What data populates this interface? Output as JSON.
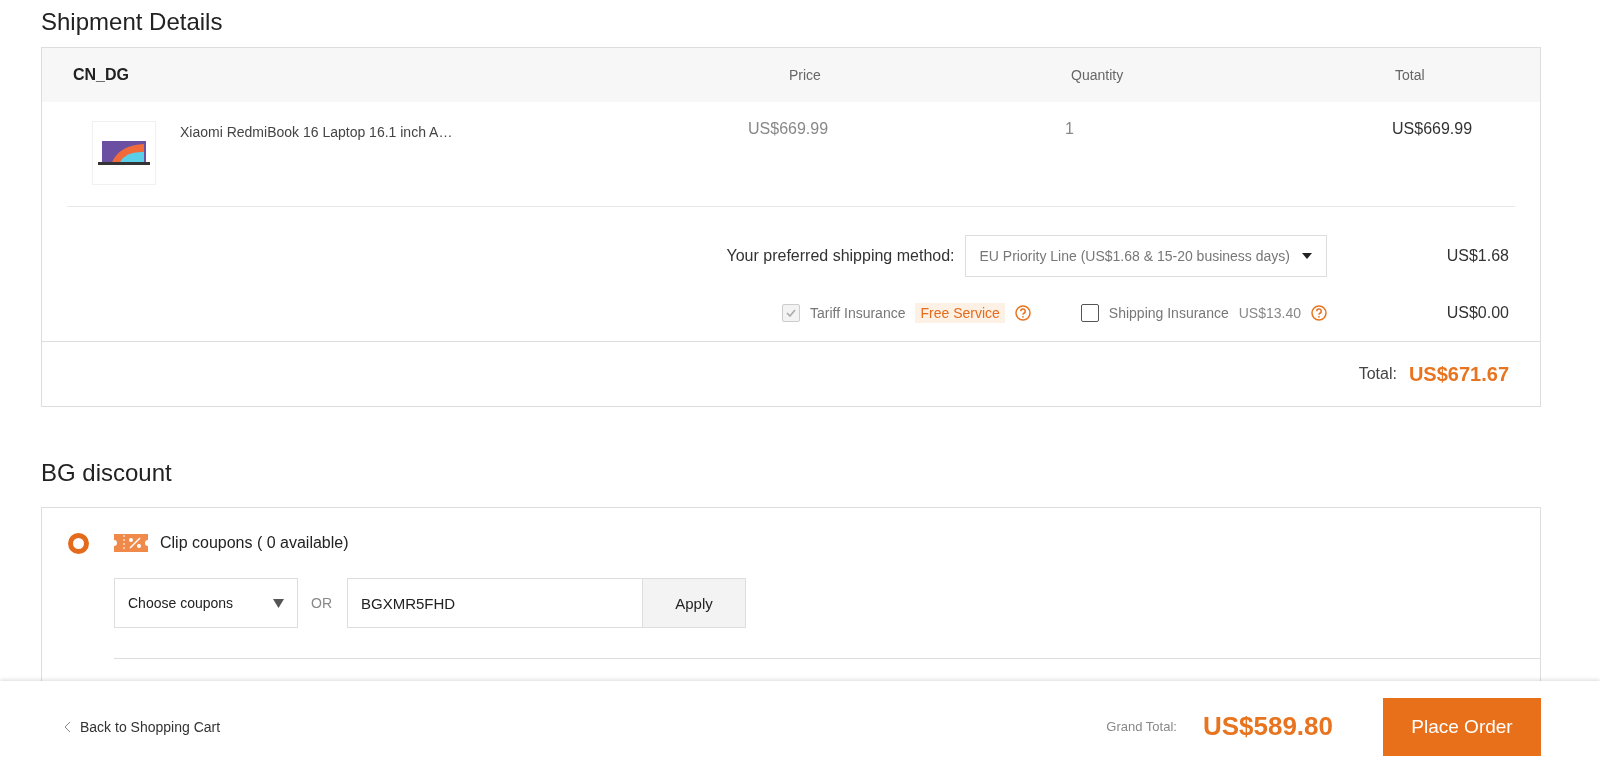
{
  "shipment": {
    "title": "Shipment Details",
    "warehouse": "CN_DG",
    "columns": [
      "Price",
      "Quantity",
      "Total"
    ],
    "item": {
      "name": "Xiaomi RedmiBook 16 Laptop 16.1 inch A…",
      "price": "US$669.99",
      "quantity": "1",
      "total": "US$669.99"
    },
    "shipping": {
      "label": "Your preferred shipping method:",
      "method": "EU Priority Line (US$1.68 & 15-20 business days)",
      "cost": "US$1.68"
    },
    "insurance": [
      {
        "label": "Tariff Insurance",
        "checked": true,
        "disabled": true,
        "badge": "Free Service"
      },
      {
        "label": "Shipping Insurance",
        "checked": false,
        "disabled": false,
        "price": "US$13.40"
      }
    ],
    "insurance_cost": "US$0.00",
    "total_label": "Total:",
    "total": "US$671.67"
  },
  "discount": {
    "title": "BG discount",
    "option": {
      "label": "Clip coupons ( 0 available)",
      "selected": true
    },
    "coupon_select": "Choose coupons",
    "or": "OR",
    "code": "BGXMR5FHD",
    "apply": "Apply"
  },
  "footer": {
    "back": "Back to Shopping Cart",
    "grand_label": "Grand Total:",
    "grand_total": "US$589.80",
    "place_order": "Place Order"
  }
}
